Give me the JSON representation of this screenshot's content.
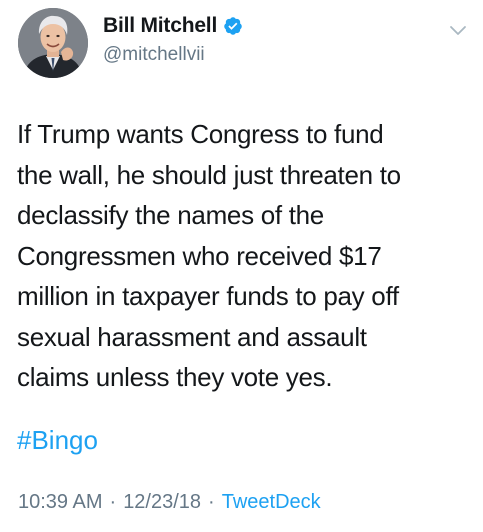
{
  "user": {
    "display_name": "Bill Mitchell",
    "handle": "@mitchellvii",
    "verified": true
  },
  "tweet": {
    "text": "If Trump wants Congress to fund\nthe wall, he should just threaten to\ndeclassify the names of the\nCongressmen who received $17\nmillion in taxpayer funds to pay off\nsexual harassment and assault\nclaims unless they vote yes.",
    "hashtag": "#Bingo",
    "time": "10:39 AM",
    "separator": "·",
    "date": "12/23/18",
    "source": "TweetDeck"
  },
  "icons": {
    "verified": "verified-badge-icon",
    "menu": "chevron-down-icon"
  },
  "colors": {
    "link": "#1da1f2",
    "secondary_text": "#657786",
    "primary_text": "#14171a"
  }
}
